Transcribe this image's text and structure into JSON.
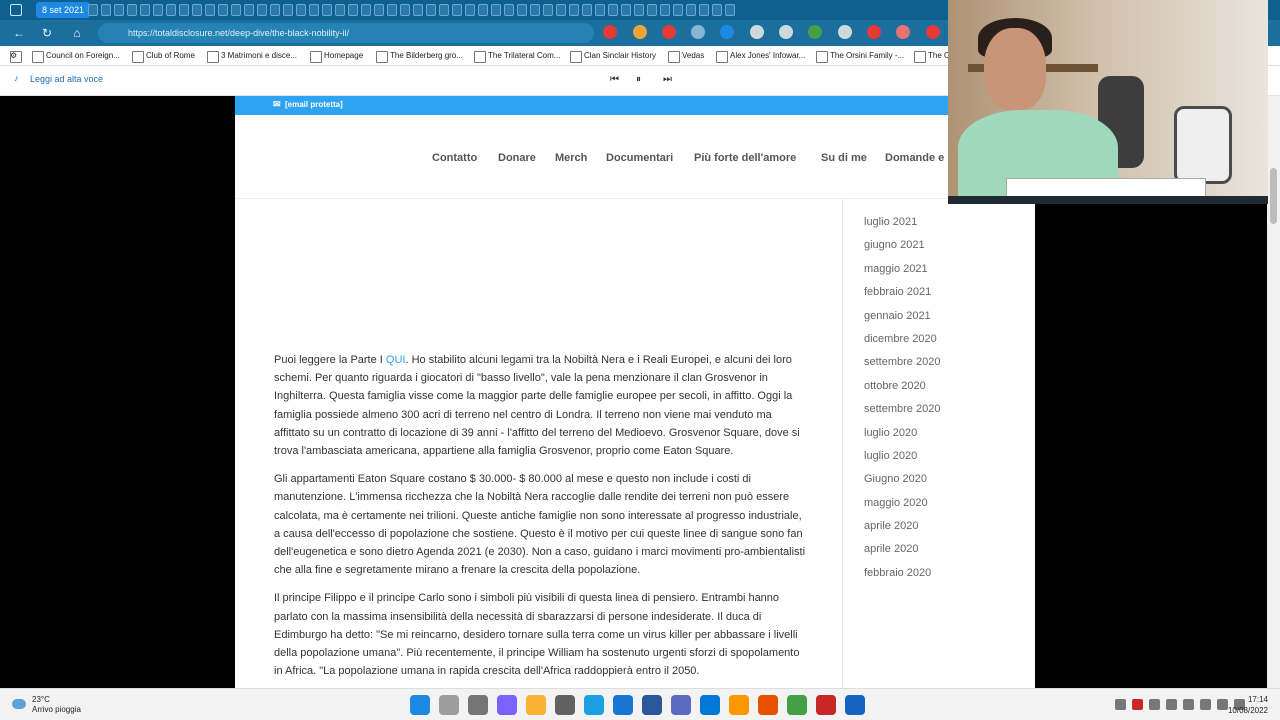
{
  "browser": {
    "date_tab": "8 set 2021",
    "url": "https://totaldisclosure.net/deep-dive/the-black-nobility-ii/",
    "bookmarks": [
      "Council on Foreign...",
      "Club of Rome",
      "3 Matrimoni e disce...",
      "Homepage",
      "The Bilderberg gro...",
      "The Trilateral Com...",
      "Clan Sinclair History",
      "Vedas",
      "Alex Jones' Infowar...",
      "The Orsini Family -...",
      "The C"
    ],
    "read_aloud": "Leggi ad alta voce",
    "controls": {
      "prev": "⏮",
      "pause": "⏸",
      "next": "⏭"
    }
  },
  "site": {
    "top_email": "[email protetta]",
    "menu": [
      "Contatto",
      "Donare",
      "Merch",
      "Documentari",
      "Più forte dell'amore",
      "Su di me",
      "Domande e"
    ],
    "paragraphs": [
      {
        "pre": "Puoi leggere la Parte I ",
        "link": "QUI",
        "post": ". Ho stabilito alcuni legami tra la Nobiltà Nera e i Reali Europei, e alcuni dei loro schemi. Per quanto riguarda i giocatori di \"basso livello\", vale la pena menzionare il clan Grosvenor in Inghilterra. Questa famiglia visse come la maggior parte delle famiglie europee per secoli, in affitto. Oggi la famiglia possiede almeno 300 acri di terreno nel centro di Londra. Il terreno non viene mai venduto ma affittato su un contratto di locazione di 39 anni - l'affitto del terreno del Medioevo. Grosvenor Square, dove si trova l'ambasciata americana, appartiene alla famiglia Grosvenor, proprio come Eaton Square."
      },
      {
        "text": "Gli appartamenti Eaton Square costano $ 30.000- $ 80.000 al mese e questo non include i costi di manutenzione. L'immensa ricchezza che la Nobiltà Nera raccoglie dalle rendite dei terreni non può essere calcolata, ma è certamente nei trilioni. Queste antiche famiglie non sono interessate al progresso industriale, a causa dell'eccesso di popolazione che sostiene. Questo è il motivo per cui queste linee di sangue sono fan dell'eugenetica e sono dietro Agenda 2021 (e 2030). Non a caso, guidano i marci movimenti pro-ambientalisti che alla fine e segretamente mirano a frenare la crescita della popolazione."
      },
      {
        "text": "Il principe Filippo e il principe Carlo sono i simboli più visibili di questa linea di pensiero. Entrambi hanno parlato con la massima insensibilità della necessità di sbarazzarsi di persone indesiderate. Il duca di Edimburgo ha detto: \"Se mi reincarno, desidero tornare sulla terra come un virus killer per abbassare i livelli della popolazione umana\". Più recentemente, il principe William ha sostenuto urgenti sforzi di spopolamento in Africa. \"La popolazione umana in rapida crescita dell'Africa raddoppierà entro il 2050."
      }
    ],
    "archive": [
      "luglio 2021",
      "giugno 2021",
      "maggio 2021",
      "febbraio 2021",
      "gennaio 2021",
      "dicembre 2020",
      "settembre 2020",
      "ottobre 2020",
      "settembre 2020",
      "luglio 2020",
      "luglio 2020",
      "Giugno 2020",
      "maggio 2020",
      "aprile 2020",
      "aprile 2020",
      "febbraio 2020"
    ]
  },
  "taskbar": {
    "temp": "23°C",
    "weather": "Arrivo pioggia",
    "time": "17:14",
    "date": "10/08/2022"
  },
  "colors": {
    "accent": "#2ea3f2",
    "browser_chrome": "#1a6f9f",
    "tab_bar": "#0f5f8f"
  }
}
